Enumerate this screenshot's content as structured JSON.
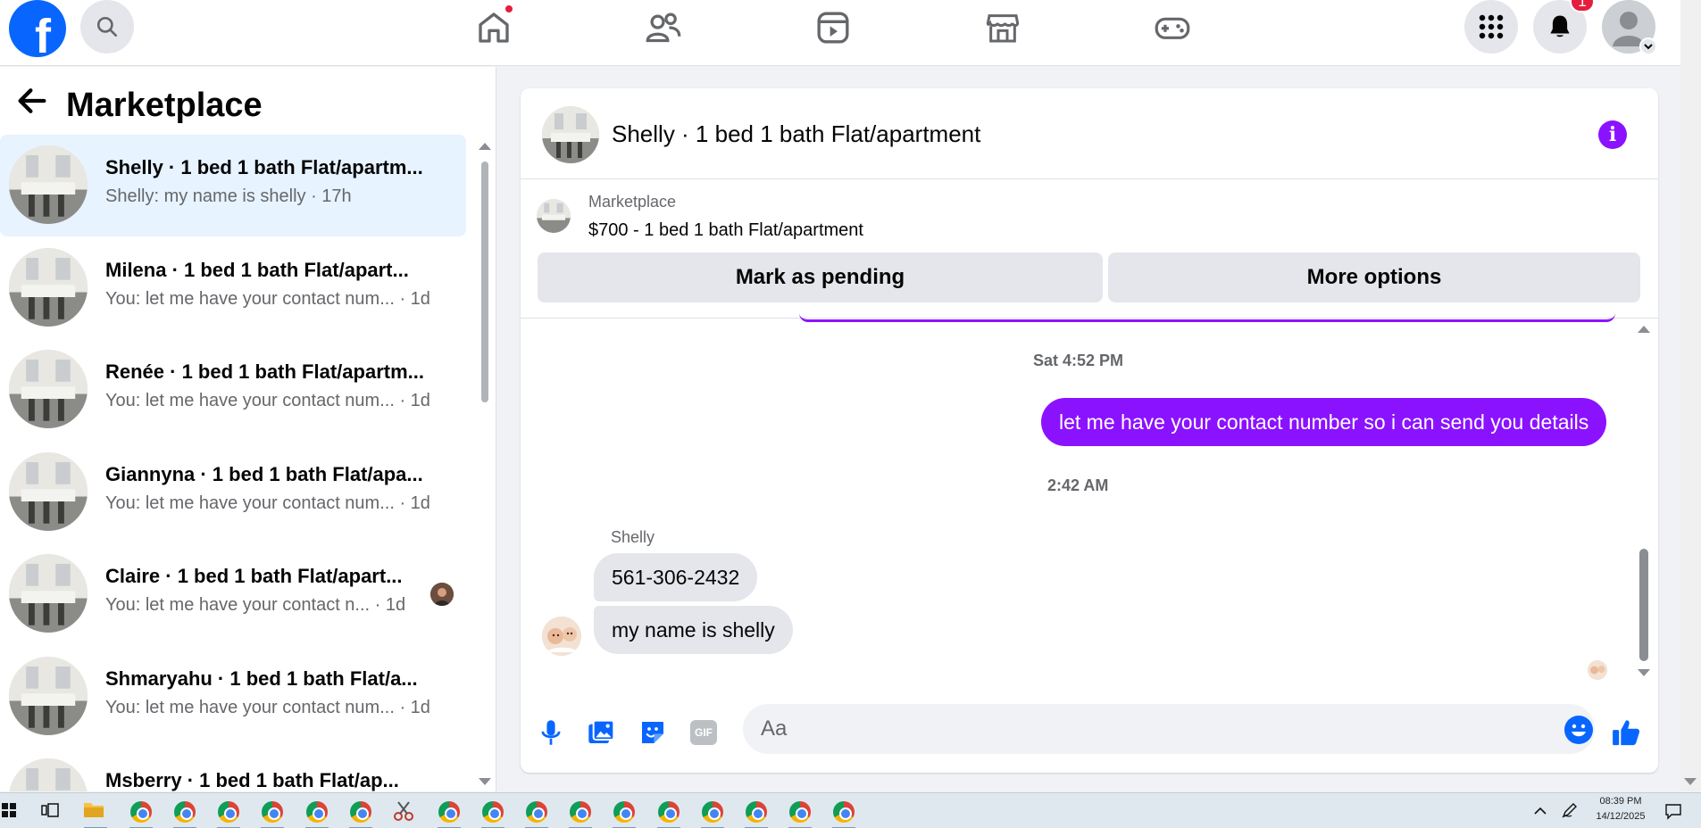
{
  "topnav": {
    "logo_letter": "f",
    "notifications_badge": "1"
  },
  "sidebar": {
    "title": "Marketplace",
    "conversations": [
      {
        "name": "Shelly · 1 bed 1 bath Flat/apartm...",
        "preview": "Shelly: my name is shelly · 17h",
        "active": true
      },
      {
        "name": "Milena · 1 bed 1 bath Flat/apart...",
        "preview": "You: let me have your contact num... · 1d"
      },
      {
        "name": "Renée · 1 bed 1 bath Flat/apartm...",
        "preview": "You: let me have your contact num... · 1d"
      },
      {
        "name": "Giannyna · 1 bed 1 bath Flat/apa...",
        "preview": "You: let me have your contact num... · 1d"
      },
      {
        "name": "Claire · 1 bed 1 bath Flat/apart...",
        "preview": "You: let me have your contact n... · 1d"
      },
      {
        "name": "Shmaryahu · 1 bed 1 bath Flat/a...",
        "preview": "You: let me have your contact num... · 1d"
      },
      {
        "name": "Msberry · 1 bed 1 bath Flat/ap...",
        "preview": ""
      }
    ]
  },
  "chat": {
    "title": "Shelly · 1 bed 1 bath Flat/apartment",
    "marketplace_label": "Marketplace",
    "listing": "$700 - 1 bed 1 bath Flat/apartment",
    "mark_pending": "Mark as pending",
    "more_options": "More options",
    "messages": {
      "ts1": "Sat 4:52 PM",
      "outgoing": "let me have your contact number so i can send you details",
      "ts2": "2:42 AM",
      "sender": "Shelly",
      "in1": "561-306-2432",
      "in2": "my name is shelly"
    },
    "composer_placeholder": "Aa",
    "gif_label": "GIF"
  },
  "taskbar": {
    "time": "08:39 PM",
    "date": "14/12/2025"
  },
  "colors": {
    "brand_blue": "#0866ff",
    "messenger_purple": "#8b12ff",
    "active_row": "#e7f3ff",
    "badge_red": "#e41e3f"
  }
}
